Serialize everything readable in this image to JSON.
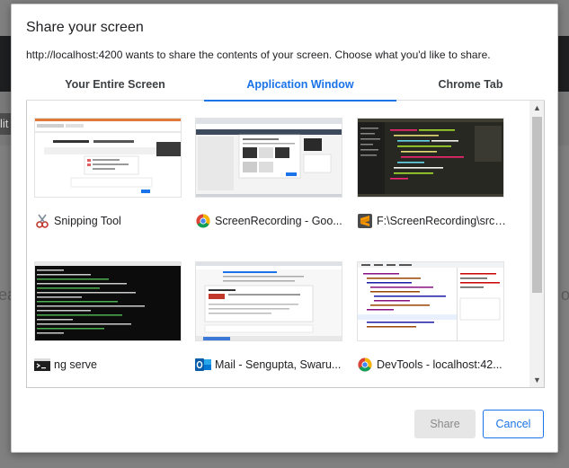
{
  "background_page": {
    "left_letter": "ea",
    "right_letter": "o",
    "chip_text": "lit"
  },
  "dialog": {
    "title": "Share your screen",
    "description": "http://localhost:4200 wants to share the contents of your screen. Choose what you'd like to share."
  },
  "tabs": [
    {
      "label": "Your Entire Screen",
      "selected": false
    },
    {
      "label": "Application Window",
      "selected": true
    },
    {
      "label": "Chrome Tab",
      "selected": false
    }
  ],
  "windows": [
    {
      "label": "Snipping Tool",
      "icon": "snipping-tool-icon"
    },
    {
      "label": "ScreenRecording - Goo...",
      "icon": "chrome-icon"
    },
    {
      "label": "F:\\ScreenRecording\\src\\...",
      "icon": "sublime-text-icon"
    },
    {
      "label": "ng serve",
      "icon": "terminal-icon"
    },
    {
      "label": "Mail - Sengupta, Swaru...",
      "icon": "outlook-icon"
    },
    {
      "label": "DevTools - localhost:42...",
      "icon": "chrome-icon"
    }
  ],
  "buttons": {
    "share": "Share",
    "cancel": "Cancel"
  },
  "colors": {
    "accent": "#1a73e8",
    "disabled_button": "#e6e6e6"
  }
}
